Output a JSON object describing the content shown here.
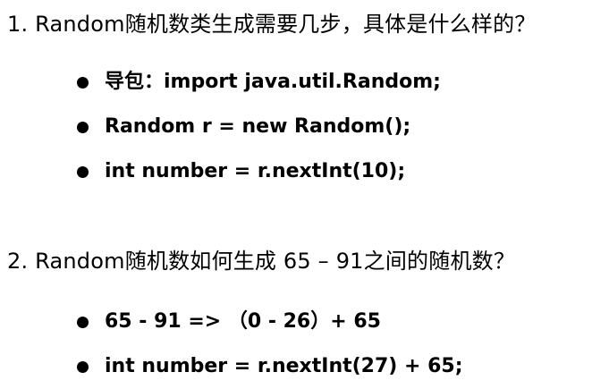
{
  "section1": {
    "question": "1. Random随机数类生成需要几步，具体是什么样的？",
    "items": [
      "导包：import java.util.Random;",
      "Random r = new Random();",
      "int number = r.nextInt(10);"
    ]
  },
  "section2": {
    "question": "2. Random随机数如何生成 65 – 91之间的随机数？",
    "items": [
      "65 - 91 =>  （0 - 26）+ 65",
      "int number = r.nextInt(27) + 65;"
    ]
  }
}
